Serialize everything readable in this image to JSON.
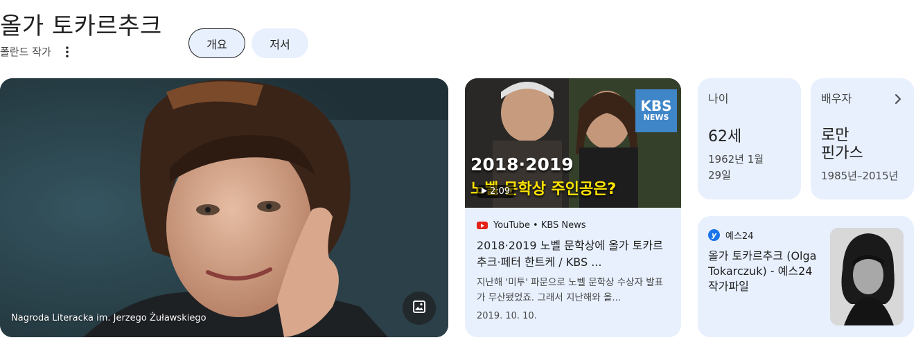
{
  "header": {
    "title": "올가 토카르추크",
    "subtitle": "폴란드 작가",
    "tabs": [
      {
        "label": "개요",
        "selected": true
      },
      {
        "label": "저서",
        "selected": false
      }
    ]
  },
  "main_photo": {
    "caption": "Nagroda Literacka im. Jerzego Żuławskiego"
  },
  "video": {
    "thumbnail": {
      "logo_line1": "KBS",
      "logo_line2": "NEWS",
      "year_text": "2018·2019",
      "headline_text": "노벨 문학상 주인공은?"
    },
    "duration": "2:09",
    "source": "YouTube • KBS News",
    "title": "2018·2019 노벨 문학상에 올가 토카르추크·페터 한트케 / KBS ...",
    "description": "지난해 '미투' 파문으로 노벨 문학상 수상자 발표가 무산됐었죠. 그래서 지난해와 올...",
    "date": "2019. 10. 10."
  },
  "age_card": {
    "label": "나이",
    "value": "62세",
    "birth_line1": "1962년 1월",
    "birth_line2": "29일"
  },
  "spouse_card": {
    "label": "배우자",
    "name_line1": "로만",
    "name_line2": "핀가스",
    "years": "1985년–2015년"
  },
  "yes24_card": {
    "logo_letter": "y",
    "source": "예스24",
    "title": "올가 토카르추크 (Olga Tokarczuk) - 예스24 작가파일"
  },
  "colors": {
    "card_background": "#e8f0fe",
    "text_primary": "#1f1f1f",
    "text_secondary": "#474747",
    "youtube_red": "#e62117",
    "kbs_blue": "#3f86c8",
    "headline_yellow": "#ffe400"
  }
}
